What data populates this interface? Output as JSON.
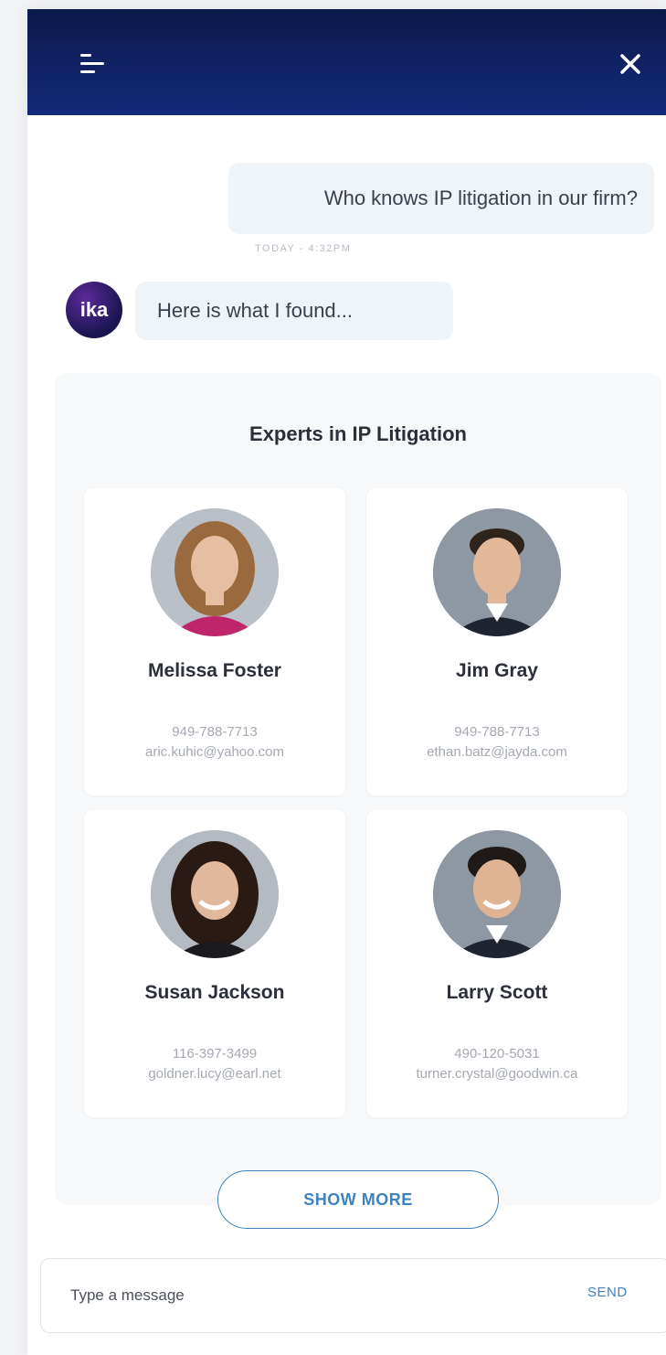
{
  "colors": {
    "header_gradient_start": "#0b1a4a",
    "header_gradient_end": "#13297a",
    "bubble_bg": "#eef4f7",
    "accent": "#3e82c2",
    "bot_avatar": "#2a1a6e"
  },
  "header": {
    "menu_icon": "menu-icon",
    "close_icon": "close-icon"
  },
  "conversation": {
    "user_message": "Who knows IP litigation in our firm?",
    "timestamp": "TODAY - 4:32PM",
    "bot_avatar_label": "ika",
    "bot_message": "Here is what I found..."
  },
  "results": {
    "title": "Experts in IP Litigation",
    "experts": [
      {
        "name": "Melissa Foster",
        "phone": "949-788-7713",
        "email": "aric.kuhic@yahoo.com"
      },
      {
        "name": "Jim Gray",
        "phone": "949-788-7713",
        "email": "ethan.batz@jayda.com"
      },
      {
        "name": "Susan Jackson",
        "phone": "116-397-3499",
        "email": "goldner.lucy@earl.net"
      },
      {
        "name": "Larry Scott",
        "phone": "490-120-5031",
        "email": "turner.crystal@goodwin.ca"
      }
    ],
    "show_more_label": "SHOW MORE"
  },
  "composer": {
    "placeholder": "Type a message",
    "value": "",
    "send_label": "SEND"
  }
}
